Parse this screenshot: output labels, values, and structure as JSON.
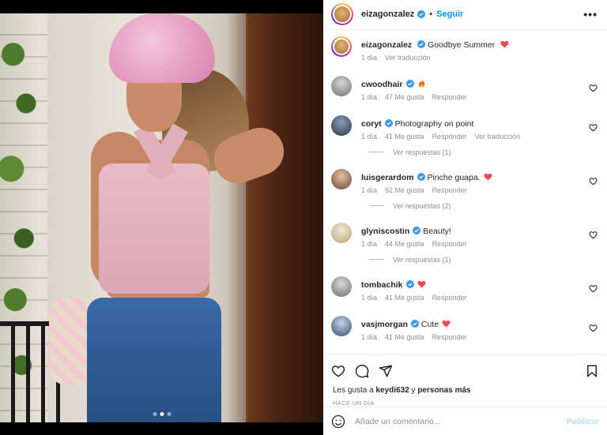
{
  "post": {
    "author": "eizagonzalez",
    "follow_label": "Seguir",
    "more_label": "•••",
    "separator": "•"
  },
  "caption": {
    "author": "eizagonzalez",
    "text": "Goodbye Summer",
    "time": "1 día",
    "translate_label": "Ver traducción"
  },
  "comments": [
    {
      "user": "cwoodhair",
      "text": "",
      "emoji": "fire",
      "time": "1 día",
      "likes": "47 Me gusta",
      "reply_label": "Responder",
      "translate_label": "",
      "replies_label": ""
    },
    {
      "user": "coryt",
      "text": "Photography on point",
      "emoji": "",
      "time": "1 día",
      "likes": "41 Me gusta",
      "reply_label": "Responder",
      "translate_label": "Ver traducción",
      "replies_label": "Ver respuestas (1)"
    },
    {
      "user": "luisgerardom",
      "text": "Pinche guapa.",
      "emoji": "heart",
      "time": "1 día",
      "likes": "92 Me gusta",
      "reply_label": "Responder",
      "translate_label": "",
      "replies_label": "Ver respuestas (2)"
    },
    {
      "user": "glyniscostin",
      "text": "Beauty!",
      "emoji": "",
      "time": "1 día",
      "likes": "44 Me gusta",
      "reply_label": "Responder",
      "translate_label": "",
      "replies_label": "Ver respuestas (1)"
    },
    {
      "user": "tombachik",
      "text": "",
      "emoji": "heart",
      "time": "1 día",
      "likes": "41 Me gusta",
      "reply_label": "Responder",
      "translate_label": "",
      "replies_label": ""
    },
    {
      "user": "vasjmorgan",
      "text": "Cute",
      "emoji": "heart",
      "time": "1 día",
      "likes": "41 Me gusta",
      "reply_label": "Responder",
      "translate_label": "",
      "replies_label": ""
    }
  ],
  "likes_line": {
    "prefix": "Les gusta a",
    "user": "keydi632",
    "connector": "y",
    "others": "personas más"
  },
  "posted_ago": "HACE UN DÍA",
  "comment_box": {
    "placeholder": "Añade un comentario...",
    "publish_label": "Publicar"
  },
  "colors": {
    "accent": "#0095f6",
    "publish_disabled": "#b2dffc",
    "heart_red": "#ed4956",
    "secondary_text": "#8e8e8e"
  },
  "carousel": {
    "count": 3,
    "active_index": 1
  }
}
